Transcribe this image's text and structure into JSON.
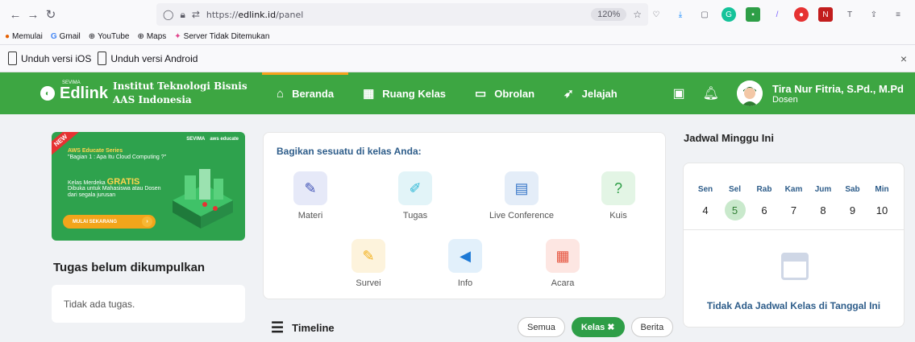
{
  "browser": {
    "url_prefix": "https://",
    "url_host": "edlink.id",
    "url_path": "/panel",
    "zoom": "120%"
  },
  "bookmarks": [
    "Memulai",
    "Gmail",
    "YouTube",
    "Maps",
    "Server Tidak Ditemukan"
  ],
  "appbar": {
    "ios": "Unduh versi iOS",
    "android": "Unduh versi Android"
  },
  "header": {
    "brand": "Edlink",
    "brand_small": "SEVIMA",
    "institution": "Institut Teknologi Bisnis AAS Indonesia",
    "nav": [
      "Beranda",
      "Ruang Kelas",
      "Obrolan",
      "Jelajah"
    ],
    "user_name": "Tira Nur Fitria, S.Pd., M.Pd",
    "user_role": "Dosen"
  },
  "banner": {
    "ribbon": "NEW",
    "brand1": "SEVIMA",
    "brand2": "aws educate",
    "series": "AWS Educate Series",
    "sub": "\"Bagian 1 : Apa Itu Cloud Computing ?\"",
    "line1_pre": "Kelas Merdeka",
    "line1_hl": "GRATIS",
    "line2": "Dibuka untuk Mahasiswa atau Dosen dari segala jurusan",
    "cta": "MULAI SEKARANG",
    "cta_arrow": "›"
  },
  "tugas": {
    "title": "Tugas belum dikumpulkan",
    "empty": "Tidak ada tugas."
  },
  "share": {
    "title": "Bagikan sesuatu di kelas Anda:",
    "items": [
      "Materi",
      "Tugas",
      "Live Conference",
      "Kuis",
      "Survei",
      "Info",
      "Acara"
    ]
  },
  "timeline": {
    "label": "Timeline",
    "filters": [
      "Semua",
      "Kelas ✖",
      "Berita"
    ]
  },
  "jadwal": {
    "title": "Jadwal Minggu Ini",
    "days": [
      {
        "name": "Sen",
        "num": "4"
      },
      {
        "name": "Sel",
        "num": "5"
      },
      {
        "name": "Rab",
        "num": "6"
      },
      {
        "name": "Kam",
        "num": "7"
      },
      {
        "name": "Jum",
        "num": "8"
      },
      {
        "name": "Sab",
        "num": "9"
      },
      {
        "name": "Min",
        "num": "10"
      }
    ],
    "empty": "Tidak Ada Jadwal Kelas di Tanggal Ini"
  },
  "colors": {
    "primary_green": "#3da642",
    "accent_orange": "#f7a21b",
    "selected_day": "#c9e9cc"
  }
}
